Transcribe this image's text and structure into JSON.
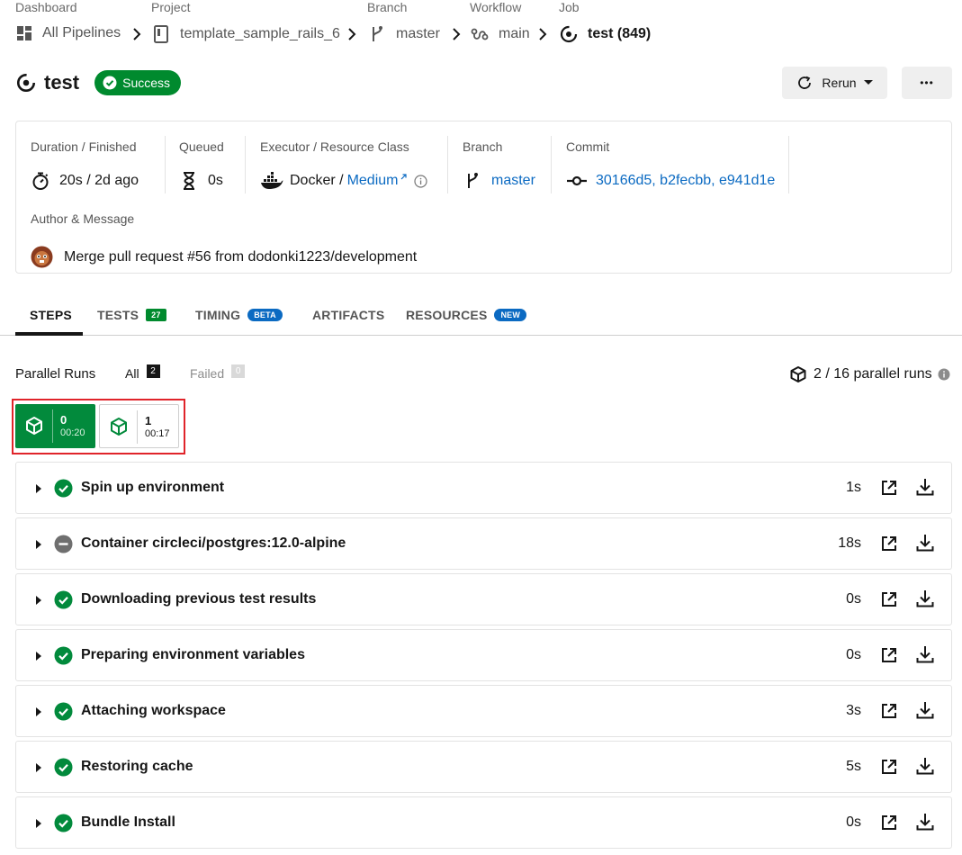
{
  "breadcrumbs": [
    {
      "label": "Dashboard",
      "value": "All Pipelines",
      "icon": "dashboard-icon"
    },
    {
      "label": "Project",
      "value": "template_sample_rails_6",
      "icon": "project-icon"
    },
    {
      "label": "Branch",
      "value": "master",
      "icon": "branch-icon"
    },
    {
      "label": "Workflow",
      "value": "main",
      "icon": "workflow-icon"
    },
    {
      "label": "Job",
      "value": "test (849)",
      "icon": "job-icon"
    }
  ],
  "header": {
    "title": "test",
    "status": "Success",
    "rerun_label": "Rerun",
    "more_label": "•••"
  },
  "info": {
    "duration_label": "Duration / Finished",
    "duration_value": "20s / 2d ago",
    "queued_label": "Queued",
    "queued_value": "0s",
    "executor_label": "Executor / Resource Class",
    "executor_value": "Docker / ",
    "resource_class": "Medium",
    "branch_label": "Branch",
    "branch_value": "master",
    "commit_label": "Commit",
    "commit_value": "30166d5, b2fecbb, e941d1e",
    "author_label": "Author & Message",
    "author_message": "Merge pull request #56 from dodonki1223/development"
  },
  "tabs": [
    {
      "label": "STEPS",
      "active": true
    },
    {
      "label": "TESTS",
      "badge": "27"
    },
    {
      "label": "TIMING",
      "badge": "BETA"
    },
    {
      "label": "ARTIFACTS"
    },
    {
      "label": "RESOURCES",
      "badge": "NEW"
    }
  ],
  "parallel": {
    "title": "Parallel Runs",
    "all_label": "All",
    "all_count": "2",
    "failed_label": "Failed",
    "failed_count": "0",
    "summary": "2 / 16 parallel runs",
    "runs": [
      {
        "index": "0",
        "time": "00:20",
        "selected": true
      },
      {
        "index": "1",
        "time": "00:17",
        "selected": false
      }
    ]
  },
  "steps": [
    {
      "name": "Spin up environment",
      "duration": "1s",
      "status": "success"
    },
    {
      "name": "Container circleci/postgres:12.0-alpine",
      "duration": "18s",
      "status": "neutral"
    },
    {
      "name": "Downloading previous test results",
      "duration": "0s",
      "status": "success"
    },
    {
      "name": "Preparing environment variables",
      "duration": "0s",
      "status": "success"
    },
    {
      "name": "Attaching workspace",
      "duration": "3s",
      "status": "success"
    },
    {
      "name": "Restoring cache",
      "duration": "5s",
      "status": "success"
    },
    {
      "name": "Bundle Install",
      "duration": "0s",
      "status": "success"
    }
  ],
  "colors": {
    "success": "#028a3c",
    "link": "#0b6ac2",
    "highlight": "#e0242a"
  }
}
